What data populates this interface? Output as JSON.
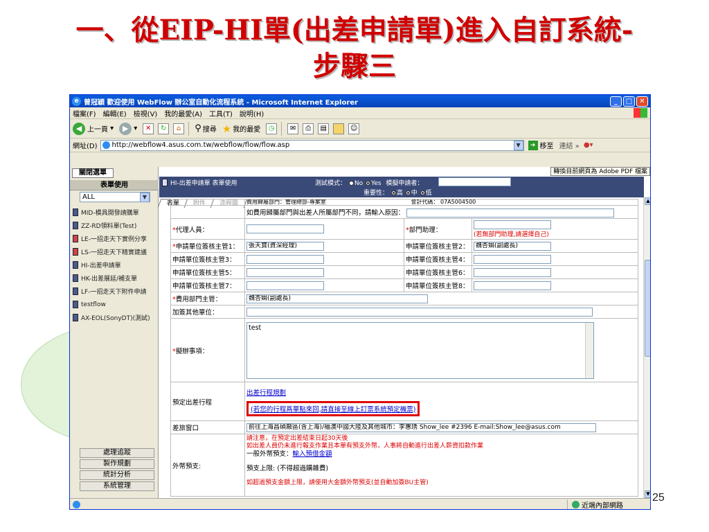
{
  "slide": {
    "title_line1": "一、從EIP-HI單(出差申請單)進入自訂系統-",
    "title_line2": "步驟三",
    "page_number": "25"
  },
  "window": {
    "title": "曾冠穎 歡迎使用 WebFlow 辦公室自動化流程系統 - Microsoft Internet Explorer",
    "controls": {
      "minimize": "_",
      "maximize": "□",
      "close": "✕"
    }
  },
  "menubar": [
    "檔案(F)",
    "編輯(E)",
    "檢視(V)",
    "我的最愛(A)",
    "工具(T)",
    "說明(H)"
  ],
  "toolbar": {
    "back": "上一頁",
    "search": "搜尋",
    "favorites": "我的最愛"
  },
  "addressbar": {
    "label": "網址(D)",
    "url": "http://webflow4.asus.com.tw/webflow/flow/flow.asp",
    "go": "移至",
    "links": "連結"
  },
  "leftframe": {
    "tab": "關閉選單",
    "header": "表單使用",
    "select_value": "ALL",
    "items": [
      {
        "label": "MID-模具開發請購單",
        "icon": "doc"
      },
      {
        "label": "ZZ-RD領料單(Test)",
        "icon": "doc"
      },
      {
        "label": "LE-一招走天下實例分享",
        "icon": "red"
      },
      {
        "label": "LS-一招走天下精實建議",
        "icon": "red"
      },
      {
        "label": "HI-出差申請單",
        "icon": "doc"
      },
      {
        "label": "HK-出差展延/補支單",
        "icon": "doc"
      },
      {
        "label": "LF-一招走天下附件申請",
        "icon": "doc"
      },
      {
        "label": "testflow",
        "icon": "doc"
      },
      {
        "label": "AX-EOL(SonyDT)(測試)",
        "icon": "doc"
      }
    ],
    "bottom_buttons": [
      "處理追蹤",
      "製作規劃",
      "統計分析",
      "系統管理"
    ]
  },
  "form_header": {
    "title": "HI-出差申請單 表單使用",
    "test_mode_label": "測試模式：",
    "test_no": "No",
    "test_yes": "Yes",
    "simulate_label": "模擬申請者：",
    "importance_label": "重要性：",
    "imp_high": "高",
    "imp_mid": "中",
    "imp_low": "低",
    "pdf_button": "轉換目前網頁為 Adobe PDF 檔案",
    "tabs": [
      "表單",
      "附件",
      "流程圖"
    ]
  },
  "form": {
    "partial_top": "費用歸屬部門：管理總部-專案室",
    "partial_top_right_label": "會計代碼：",
    "partial_top_right_value": "07A5004500",
    "reason_label": "如費用歸屬部門與出差人所屬部門不同，請輸入原因：",
    "agent_label": "代理人員：",
    "dept_assistant_label": "部門助理：",
    "dept_assistant_note": "(若無部門助理,請選擇自己)",
    "approver1_label": "申請單位簽核主管1：",
    "approver1_value": "張天寶(資深經理)",
    "approver2_label": "申請單位簽核主管2：",
    "approver2_value": "魏杏娟(副處長)",
    "approver3_label": "申請單位簽核主管3：",
    "approver4_label": "申請單位簽核主管4：",
    "approver5_label": "申請單位簽核主管5：",
    "approver6_label": "申請單位簽核主管6：",
    "approver7_label": "申請單位簽核主管7：",
    "approver8_label": "申請單位簽核主管8：",
    "cost_dept_label": "費用部門主管：",
    "cost_dept_value": "魏杏娟(副處長)",
    "countersign_label": "加簽其他單位：",
    "matters_label": "擬辦事項：",
    "matters_value": "test",
    "itinerary_label": "預定出差行程",
    "itinerary_link": "出差行程規劃",
    "itinerary_highlight_link": "(若您的行程爲單點來回,請直接至線上訂票系統預定機票)",
    "travel_window_label": "差旅窗口",
    "travel_window_value": "前往上海昌碩廠區(含上海)/福澳中國大陸及其他城市：李惠琇 Show_lee #2396 E-mail:Show_lee@asus.com",
    "advance_label": "外幣預支:",
    "advance_note1": "請注意，在預定出差結束日起30天後",
    "advance_note2": "如出差人員仍未進行報支作業且本單有預支外幣，人事將自動進行出差人薪資扣款作業",
    "advance_general_label": "一般外幣預支：",
    "advance_general_link": "輸入預借金額",
    "advance_limit": "預支上限: (不得超過購雜費)",
    "advance_over_note": "如超過預支金額上限，請使用大金額外幣預支(並自動加簽BU主管)"
  },
  "statusbar": {
    "zone": "近端內部網路"
  }
}
